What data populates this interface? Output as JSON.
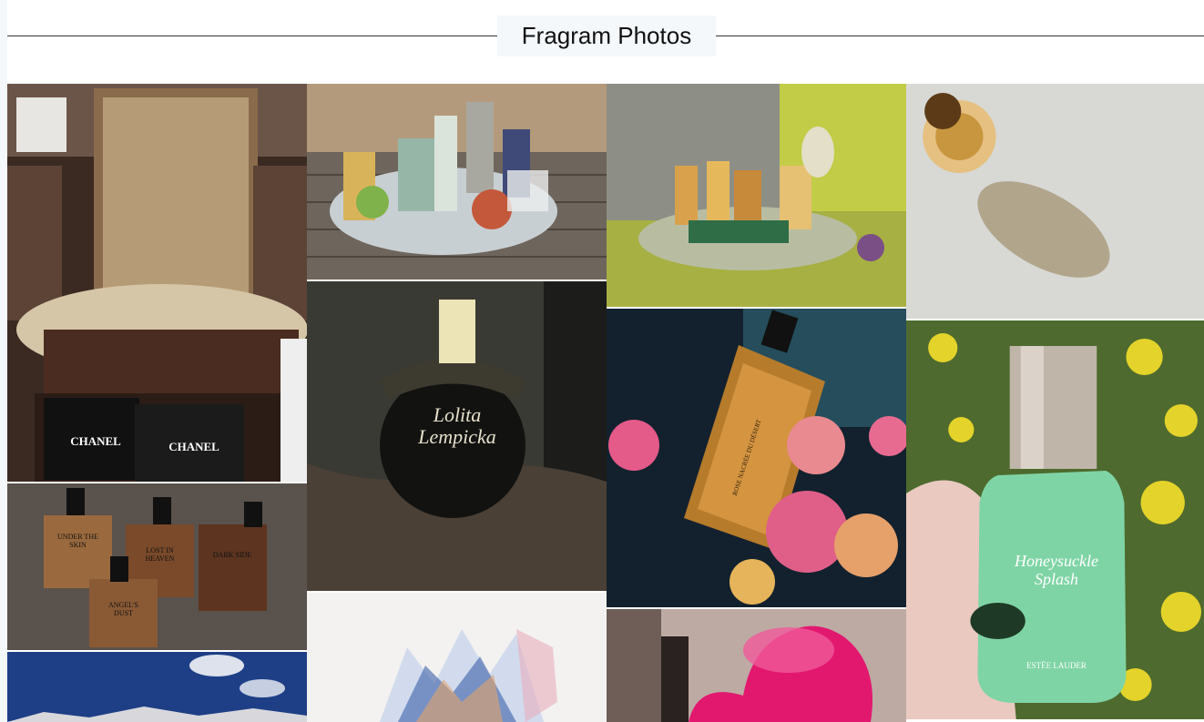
{
  "header": {
    "title": "Fragram Photos"
  },
  "photos": [
    {
      "name": "photo-perfume-shop-cabinet",
      "label": "CHANEL",
      "label2": "CHANEL"
    },
    {
      "name": "photo-perfume-bottles-on-table"
    },
    {
      "name": "photo-perfume-tray-green"
    },
    {
      "name": "photo-crystal-stopper-bottle"
    },
    {
      "name": "photo-four-perfume-bottles",
      "labels": [
        "UNDER THE SKIN",
        "LOST IN HEAVEN",
        "DARK SIDE",
        "ANGEL'S DUST"
      ]
    },
    {
      "name": "photo-lolita-lempicka-bottle",
      "label": "Lolita Lempicka"
    },
    {
      "name": "photo-rose-nacree-du-desert",
      "label": "ROSE NACRÉE DU DÉSERT"
    },
    {
      "name": "photo-honeysuckle-splash",
      "label": "Honeysuckle Splash",
      "brand": "ESTĒE LAUDER"
    },
    {
      "name": "photo-mountain-sky"
    },
    {
      "name": "photo-watercolor-art"
    },
    {
      "name": "photo-pink-glass-bottle"
    }
  ],
  "colors": {
    "accent_title_bg": "#f4f8fb",
    "rule": "#333333"
  }
}
